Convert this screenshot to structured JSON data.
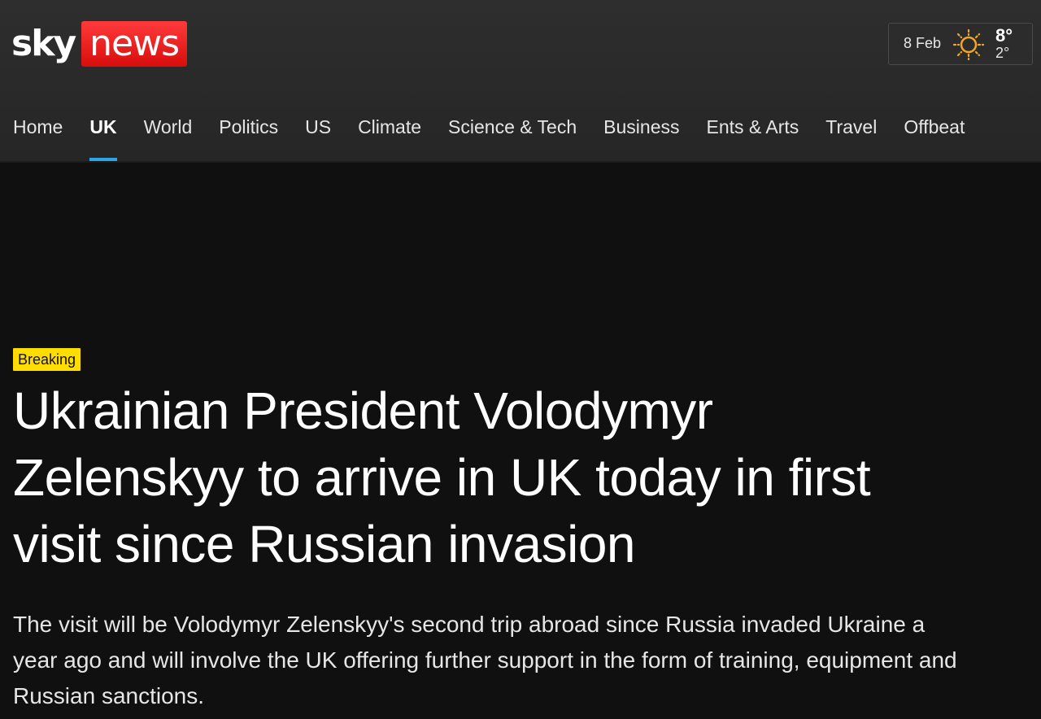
{
  "brand": {
    "sky": "sky",
    "news": "news"
  },
  "weather": {
    "date": "8 Feb",
    "icon": "sun-icon",
    "high": "8°",
    "low": "2°"
  },
  "nav": {
    "items": [
      {
        "label": "Home",
        "active": false
      },
      {
        "label": "UK",
        "active": true
      },
      {
        "label": "World",
        "active": false
      },
      {
        "label": "Politics",
        "active": false
      },
      {
        "label": "US",
        "active": false
      },
      {
        "label": "Climate",
        "active": false
      },
      {
        "label": "Science & Tech",
        "active": false
      },
      {
        "label": "Business",
        "active": false
      },
      {
        "label": "Ents & Arts",
        "active": false
      },
      {
        "label": "Travel",
        "active": false
      },
      {
        "label": "Offbeat",
        "active": false
      }
    ]
  },
  "article": {
    "badge": "Breaking",
    "headline": "Ukrainian President Volodymyr Zelenskyy to arrive in UK today in first visit since Russian invasion",
    "standfirst": "The visit will be Volodymyr Zelenskyy's second trip abroad since Russia invaded Ukraine a year ago and will involve the UK offering further support in the form of training, equipment and Russian sanctions."
  },
  "colors": {
    "brand_red": "#e10a0a",
    "active_underline": "#2ea6e6",
    "breaking_badge": "#ffdd00",
    "background": "#101010",
    "header_bg": "#2b2b2b"
  }
}
